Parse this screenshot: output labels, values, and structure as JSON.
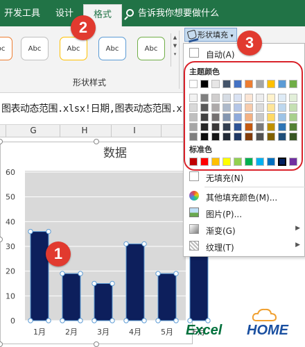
{
  "ribbon": {
    "tabs": [
      {
        "label": "开发工具"
      },
      {
        "label": "设计"
      },
      {
        "label": "格式"
      }
    ],
    "tell_me": "告诉我你想要做什么",
    "shape_styles": [
      "Abc",
      "Abc",
      "Abc",
      "Abc",
      "Abc"
    ],
    "shape_styles_group": "形状样式",
    "shape_fill_button": "形状填充"
  },
  "formula_text": "图表动态范围.xlsx!日期,图表动态范围.x",
  "columns": [
    "G",
    "H",
    "I"
  ],
  "chart_data": {
    "type": "bar",
    "title": "数据",
    "categories": [
      "1月",
      "2月",
      "3月",
      "4月",
      "5月",
      "6月"
    ],
    "values": [
      36,
      19,
      15,
      31,
      19,
      30
    ],
    "ylim": [
      0,
      60
    ],
    "yticks": [
      0,
      10,
      20,
      30,
      40,
      50,
      60
    ],
    "bar_color": "#0d1f5c",
    "plot_bg": "#d9d9d9",
    "grid": true
  },
  "badges": [
    "1",
    "2",
    "3"
  ],
  "fill_menu": {
    "auto": "自动(A)",
    "theme_header": "主题颜色",
    "theme_columns": [
      [
        "#ffffff",
        "#f2f2f2",
        "#d9d9d9",
        "#bfbfbf",
        "#a6a6a6",
        "#7f7f7f"
      ],
      [
        "#000000",
        "#808080",
        "#595959",
        "#404040",
        "#262626",
        "#0d0d0d"
      ],
      [
        "#e7e6e6",
        "#d0cece",
        "#aeaaaa",
        "#757171",
        "#3a3838",
        "#161616"
      ],
      [
        "#44546a",
        "#d6dce4",
        "#adb9ca",
        "#8496b0",
        "#333f50",
        "#222a35"
      ],
      [
        "#4472c4",
        "#d9e2f3",
        "#b4c6e7",
        "#8eaadb",
        "#2f5496",
        "#1f3864"
      ],
      [
        "#ed7d31",
        "#fbe5d5",
        "#f7cbac",
        "#f4b183",
        "#c55a11",
        "#833c0b"
      ],
      [
        "#a5a5a5",
        "#ededed",
        "#dbdbdb",
        "#c9c9c9",
        "#7b7b7b",
        "#525252"
      ],
      [
        "#ffc000",
        "#fff2cc",
        "#fee599",
        "#ffd965",
        "#bf9000",
        "#7f6000"
      ],
      [
        "#5b9bd5",
        "#deebf6",
        "#bdd7ee",
        "#9dc3e6",
        "#2e75b5",
        "#1f4e79"
      ],
      [
        "#70ad47",
        "#e2efd9",
        "#c5e0b3",
        "#a8d08d",
        "#538135",
        "#375623"
      ]
    ],
    "standard_header": "标准色",
    "standard_colors": [
      "#c00000",
      "#ff0000",
      "#ffc000",
      "#ffff00",
      "#92d050",
      "#00b050",
      "#00b0f0",
      "#0070c0",
      "#002060",
      "#7030a0"
    ],
    "items": {
      "no_fill": "无填充(N)",
      "more_colors": "其他填充颜色(M)...",
      "picture": "图片(P)...",
      "gradient": "渐变(G)",
      "texture": "纹理(T)"
    }
  },
  "logo": {
    "part1": "Excel",
    "part2": "HOME"
  }
}
